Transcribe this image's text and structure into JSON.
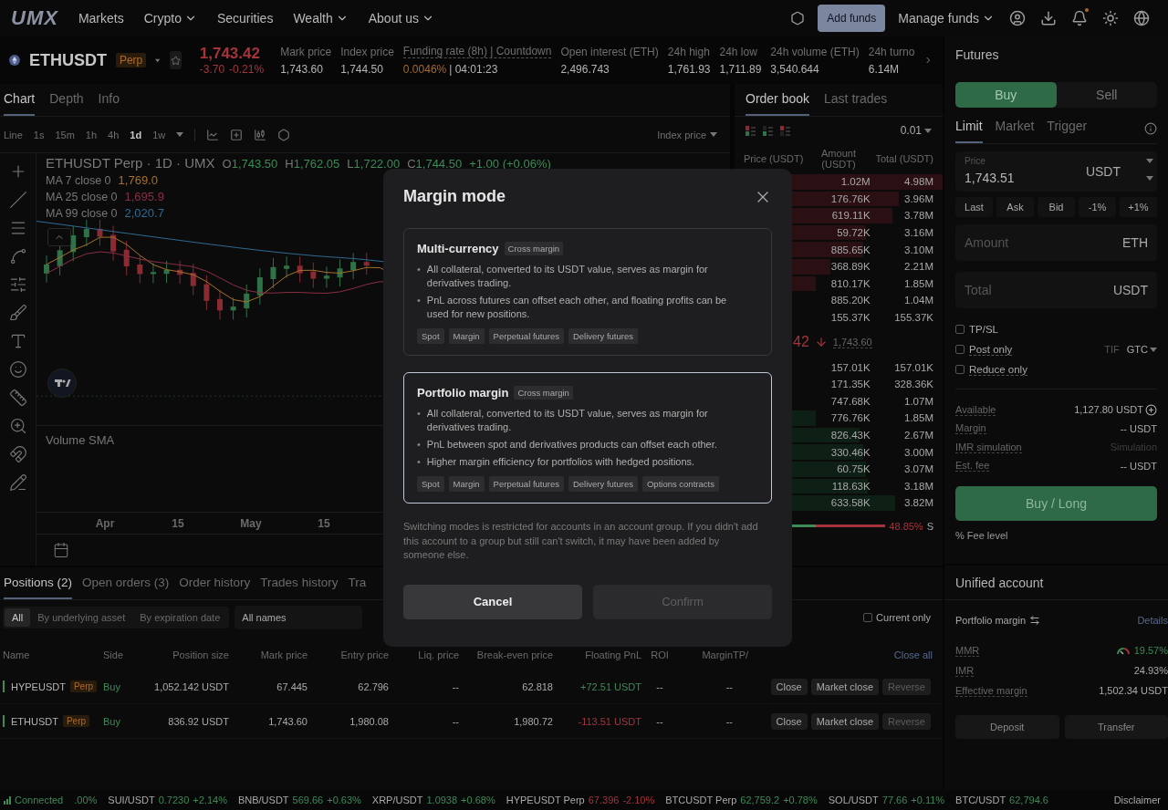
{
  "header": {
    "logo": "UMX",
    "nav": [
      {
        "label": "Markets",
        "dropdown": false
      },
      {
        "label": "Crypto",
        "dropdown": true
      },
      {
        "label": "Securities",
        "dropdown": false
      },
      {
        "label": "Wealth",
        "dropdown": true
      },
      {
        "label": "About us",
        "dropdown": true
      }
    ],
    "add_funds": "Add funds",
    "manage_funds": "Manage funds",
    "notification_dot": true
  },
  "ticker": {
    "symbol": "ETHUSDT",
    "tag": "Perp",
    "price": "1,743.42",
    "change": "-3.70",
    "change_pct": "-0.21%",
    "stats": [
      {
        "label": "Mark price",
        "value": "1,743.60",
        "kind": "plain"
      },
      {
        "label": "Index price",
        "value": "1,744.50",
        "kind": "plain"
      },
      {
        "label": "Funding rate (8h) | Countdown",
        "value": "0.0046%",
        "extra": "| 04:01:23",
        "kind": "funding"
      },
      {
        "label": "Open interest (ETH)",
        "value": "2,496.743",
        "kind": "plain"
      },
      {
        "label": "24h high",
        "value": "1,761.93",
        "kind": "plain"
      },
      {
        "label": "24h low",
        "value": "1,711.89",
        "kind": "plain"
      },
      {
        "label": "24h volume (ETH)",
        "value": "3,540.644",
        "kind": "plain"
      },
      {
        "label": "24h turno",
        "value": "6.14M",
        "kind": "plain"
      }
    ]
  },
  "chart": {
    "tabs": [
      {
        "label": "Chart",
        "selected": true
      },
      {
        "label": "Depth",
        "selected": false
      },
      {
        "label": "Info",
        "selected": false
      }
    ],
    "intervals": [
      {
        "label": "Line",
        "selected": false
      },
      {
        "label": "1s",
        "selected": false
      },
      {
        "label": "15m",
        "selected": false
      },
      {
        "label": "1h",
        "selected": false
      },
      {
        "label": "4h",
        "selected": false
      },
      {
        "label": "1d",
        "selected": true
      },
      {
        "label": "1w",
        "selected": false
      }
    ],
    "price_source": "Index price",
    "title": "ETHUSDT Perp · 1D · UMX",
    "ohlc": [
      {
        "key": "O",
        "value": "1,743.50"
      },
      {
        "key": "H",
        "value": "1,762.05"
      },
      {
        "key": "L",
        "value": "1,722.00"
      },
      {
        "key": "C",
        "value": "1,744.50"
      }
    ],
    "change": "+1.00 (+0.06%)",
    "moving_averages": [
      {
        "label": "MA 7 close 0",
        "value": "1,769.0",
        "color": "#a8702a"
      },
      {
        "label": "MA 25 close 0",
        "value": "1,695.9",
        "color": "#8a2e44"
      },
      {
        "label": "MA 99 close 0",
        "value": "2,020.7",
        "color": "#2f6a94"
      }
    ],
    "volume_label": "Volume SMA",
    "x_labels": [
      "Apr",
      "15",
      "May",
      "15"
    ]
  },
  "order_book": {
    "tabs": [
      {
        "label": "Order book",
        "selected": true
      },
      {
        "label": "Last trades",
        "selected": false
      }
    ],
    "step": "0.01",
    "columns": [
      "Price (USDT)",
      "Amount (USDT)",
      "Total (USDT)"
    ],
    "asks": [
      {
        "amount": "1.02M",
        "total": "4.98M"
      },
      {
        "amount": "176.76K",
        "total": "3.96M"
      },
      {
        "amount": "619.11K",
        "total": "3.78M"
      },
      {
        "amount": "59.72K",
        "total": "3.16M"
      },
      {
        "amount": "885.65K",
        "total": "3.10M"
      },
      {
        "amount": "368.89K",
        "total": "2.21M"
      },
      {
        "amount": "810.17K",
        "total": "1.85M"
      },
      {
        "amount": "885.20K",
        "total": "1.04M"
      },
      {
        "amount": "155.37K",
        "total": "155.37K"
      }
    ],
    "last_price": "42",
    "mark_price": "1,743.60",
    "bids": [
      {
        "amount": "157.01K",
        "total": "157.01K"
      },
      {
        "amount": "171.35K",
        "total": "328.36K"
      },
      {
        "amount": "747.68K",
        "total": "1.07M"
      },
      {
        "amount": "776.76K",
        "total": "1.85M"
      },
      {
        "amount": "826.43K",
        "total": "2.67M"
      },
      {
        "amount": "330.46K",
        "total": "3.00M"
      },
      {
        "amount": "60.75K",
        "total": "3.07M"
      },
      {
        "amount": "118.63K",
        "total": "3.18M"
      },
      {
        "amount": "633.58K",
        "total": "3.82M"
      }
    ],
    "ratio": {
      "level": 0.51,
      "sell_pct": "48.85%",
      "sell_mark": "S"
    }
  },
  "order_form": {
    "title": "Futures",
    "sides": [
      {
        "label": "Buy",
        "selected": true
      },
      {
        "label": "Sell",
        "selected": false
      }
    ],
    "types": [
      {
        "label": "Limit",
        "selected": true
      },
      {
        "label": "Market",
        "selected": false
      },
      {
        "label": "Trigger",
        "selected": false
      }
    ],
    "price": {
      "label": "Price",
      "value": "1,743.51",
      "unit": "USDT"
    },
    "quick": [
      "Last",
      "Ask",
      "Bid",
      "-1%",
      "+1%"
    ],
    "amount": {
      "placeholder": "Amount",
      "unit": "ETH"
    },
    "total": {
      "placeholder": "Total",
      "unit": "USDT"
    },
    "options": [
      {
        "label": "TP/SL",
        "checked": false,
        "underline": false
      },
      {
        "label": "Post only",
        "checked": false,
        "underline": true
      },
      {
        "label": "Reduce only",
        "checked": false,
        "underline": true
      }
    ],
    "tif_label": "TIF",
    "tif_value": "GTC",
    "info": [
      {
        "label": "Available",
        "value": "1,127.80 USDT",
        "kind": "add"
      },
      {
        "label": "Margin",
        "value": "-- USDT",
        "kind": "plain"
      },
      {
        "label": "IMR simulation",
        "value": "Simulation",
        "kind": "muted"
      },
      {
        "label": "Est. fee",
        "value": "-- USDT",
        "kind": "plain"
      }
    ],
    "submit": "Buy / Long",
    "fee": "% Fee level"
  },
  "account": {
    "title": "Unified account",
    "mode": "Portfolio margin",
    "details": "Details",
    "rows": [
      {
        "label": "MMR",
        "value": "19.57%",
        "kind": "gauge"
      },
      {
        "label": "IMR",
        "value": "24.93%",
        "kind": "plain"
      },
      {
        "label": "Effective margin",
        "value": "1,502.34 USDT",
        "kind": "plain"
      }
    ],
    "buttons": [
      "Deposit",
      "Transfer"
    ]
  },
  "positions": {
    "tabs": [
      {
        "label": "Positions (2)",
        "selected": true
      },
      {
        "label": "Open orders (3)",
        "selected": false
      },
      {
        "label": "Order history",
        "selected": false
      },
      {
        "label": "Trades history",
        "selected": false
      },
      {
        "label": "Tra",
        "selected": false
      }
    ],
    "filters": [
      {
        "label": "All",
        "selected": true
      },
      {
        "label": "By underlying asset",
        "selected": false
      },
      {
        "label": "By expiration date",
        "selected": false
      }
    ],
    "names": "All names",
    "current_only": {
      "label": "Current only",
      "checked": false
    },
    "columns": [
      "Name",
      "Side",
      "Position size",
      "Mark price",
      "Entry price",
      "Liq. price",
      "Break-even price",
      "Floating PnL",
      "ROI",
      "Margin",
      "TP/"
    ],
    "close_all": "Close all",
    "rows": [
      {
        "name": "HYPEUSDT",
        "tag": "Perp",
        "side": "Buy",
        "size": "1,052.142 USDT",
        "mark": "67.445",
        "entry": "62.796",
        "liq": "--",
        "breakeven": "62.818",
        "pnl": "+72.51 USDT",
        "kind": "profit",
        "roi": "--",
        "margin": "--",
        "actions": [
          {
            "label": "Close",
            "disabled": false
          },
          {
            "label": "Market close",
            "disabled": false
          },
          {
            "label": "Reverse",
            "disabled": true
          }
        ]
      },
      {
        "name": "ETHUSDT",
        "tag": "Perp",
        "side": "Buy",
        "size": "836.92 USDT",
        "mark": "1,743.60",
        "entry": "1,980.08",
        "liq": "--",
        "breakeven": "1,980.72",
        "pnl": "-113.51 USDT",
        "kind": "loss",
        "roi": "--",
        "margin": "--",
        "actions": [
          {
            "label": "Close",
            "disabled": false
          },
          {
            "label": "Market close",
            "disabled": false
          },
          {
            "label": "Reverse",
            "disabled": true
          }
        ]
      }
    ]
  },
  "status_bar": {
    "connection": "Connected",
    "lead": ".00%",
    "tickers": [
      {
        "pair": "SUI/USDT",
        "price": "0.7230",
        "change": "+2.14%",
        "kind": "up"
      },
      {
        "pair": "BNB/USDT",
        "price": "569.66",
        "change": "+0.63%",
        "kind": "up"
      },
      {
        "pair": "XRP/USDT",
        "price": "1.0938",
        "change": "+0.68%",
        "kind": "up"
      },
      {
        "pair": "HYPEUSDT Perp",
        "price": "67.396",
        "change": "-2.10%",
        "kind": "down"
      },
      {
        "pair": "BTCUSDT Perp",
        "price": "62,759.2",
        "change": "+0.78%",
        "kind": "up"
      },
      {
        "pair": "SOL/USDT",
        "price": "77.66",
        "change": "+0.11%",
        "kind": "up"
      },
      {
        "pair": "BTC/USDT",
        "price": "62,794.6",
        "kind": "up"
      }
    ],
    "disclaimer": "Disclaimer"
  },
  "modal": {
    "title": "Margin mode",
    "marker": "•",
    "options": [
      {
        "title": "Multi-currency",
        "badge": "Cross margin",
        "selected": false,
        "bullets": [
          "All collateral, converted to its USDT value, serves as margin for derivatives trading.",
          "PnL across futures can offset each other, and floating profits can be used for new positions."
        ],
        "tags": [
          "Spot",
          "Margin",
          "Perpetual futures",
          "Delivery futures"
        ]
      },
      {
        "title": "Portfolio margin",
        "badge": "Cross margin",
        "selected": true,
        "bullets": [
          "All collateral, converted to its USDT value, serves as margin for derivatives trading.",
          "PnL between spot and derivatives products can offset each other.",
          "Higher margin efficiency for portfolios with hedged positions."
        ],
        "tags": [
          "Spot",
          "Margin",
          "Perpetual futures",
          "Delivery futures",
          "Options contracts"
        ]
      }
    ],
    "note": "Switching modes is restricted for accounts in an account group. If you didn't add this account to a group but still can't switch, it may have been added by someone else.",
    "cancel": "Cancel",
    "confirm": {
      "label": "Confirm",
      "disabled": true
    }
  }
}
